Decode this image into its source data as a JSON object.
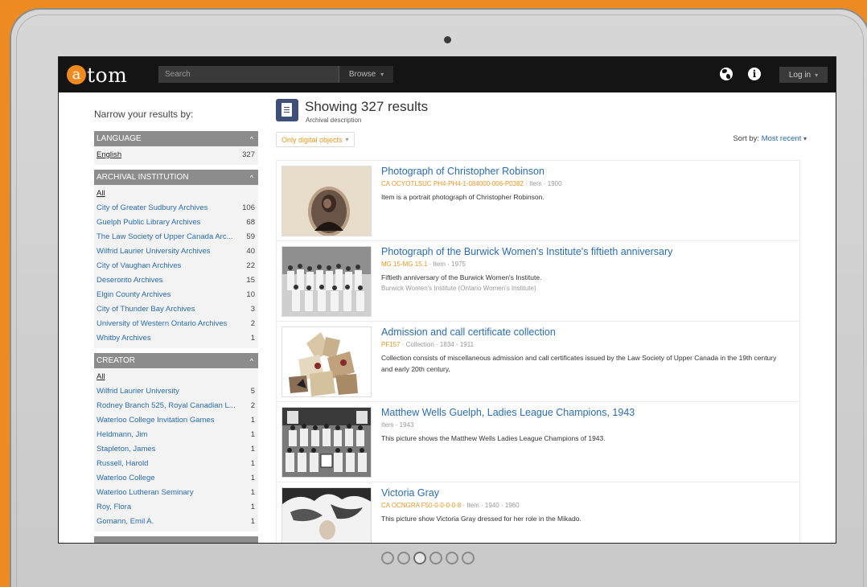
{
  "header": {
    "logo_mark": "a",
    "logo_text": "tom",
    "search_placeholder": "Search",
    "browse_label": "Browse",
    "login_label": "Log in"
  },
  "sidebar": {
    "narrow_title": "Narrow your results by:",
    "facets": [
      {
        "title": "Language",
        "items": [
          {
            "name": "English",
            "count": "327"
          }
        ]
      },
      {
        "title": "Archival institution",
        "items": [
          {
            "name": "All",
            "count": ""
          },
          {
            "name": "City of Greater Sudbury Archives",
            "count": "106"
          },
          {
            "name": "Guelph Public Library Archives",
            "count": "68"
          },
          {
            "name": "The Law Society of Upper Canada Arc...",
            "count": "59"
          },
          {
            "name": "Wilfrid Laurier University Archives",
            "count": "40"
          },
          {
            "name": "City of Vaughan Archives",
            "count": "22"
          },
          {
            "name": "Deseronto Archives",
            "count": "15"
          },
          {
            "name": "Elgin County Archives",
            "count": "10"
          },
          {
            "name": "City of Thunder Bay Archives",
            "count": "3"
          },
          {
            "name": "University of Western Ontario Archives",
            "count": "2"
          },
          {
            "name": "Whitby Archives",
            "count": "1"
          }
        ]
      },
      {
        "title": "Creator",
        "items": [
          {
            "name": "All",
            "count": ""
          },
          {
            "name": "Wilfrid Laurier University",
            "count": "5"
          },
          {
            "name": "Rodney Branch 525, Royal Canadian L...",
            "count": "2"
          },
          {
            "name": "Waterloo College Invitation Games",
            "count": "1"
          },
          {
            "name": "Heldmann, Jim",
            "count": "1"
          },
          {
            "name": "Stapleton, James",
            "count": "1"
          },
          {
            "name": "Russell, Harold",
            "count": "1"
          },
          {
            "name": "Waterloo College",
            "count": "1"
          },
          {
            "name": "Waterloo Lutheran Seminary",
            "count": "1"
          },
          {
            "name": "Roy, Flora",
            "count": "1"
          },
          {
            "name": "Gomann, Emil A.",
            "count": "1"
          }
        ]
      }
    ]
  },
  "main": {
    "title": "Showing 327 results",
    "subtitle": "Archival description",
    "filter_label": "Only digital objects",
    "sort_label": "Sort by:",
    "sort_value": "Most recent",
    "results": [
      {
        "title": "Photograph of Christopher Robinson",
        "ref": "CA OCYOTLSUC PH4-PH4-1-084000-006-P0382",
        "meta": " · Item · 1900",
        "desc": "Item is a portrait photograph of Christopher Robinson.",
        "creator": ""
      },
      {
        "title": "Photograph of the Burwick Women's Institute's fiftieth anniversary",
        "ref": "MG 15-MG 15.1",
        "meta": " · Item · 1975",
        "desc": "Fiftieth anniversary of the Burwick Women's Institute.",
        "creator": "Burwick Women's Institute (Ontario Women's Institute)"
      },
      {
        "title": "Admission and call certificate collection",
        "ref": "PF157",
        "meta": " · Collection · 1834 - 1911",
        "desc": "Collection consists of miscellaneous admission and call certificates issued by the Law Society of Upper Canada in the 19th century and early 20th century.",
        "creator": ""
      },
      {
        "title": "Matthew Wells Guelph, Ladies League Champions, 1943",
        "ref": "",
        "meta": "Item · 1943",
        "desc": "This picture shows the Matthew Wells Ladies League Champions of 1943.",
        "creator": ""
      },
      {
        "title": "Victoria Gray",
        "ref": "CA OCNGRA F50-0-0-0-0-8",
        "meta": " · Item · 1940 - 1960",
        "desc": "This picture show Victoria Gray dressed for her role in the Mikado.",
        "creator": ""
      }
    ]
  }
}
